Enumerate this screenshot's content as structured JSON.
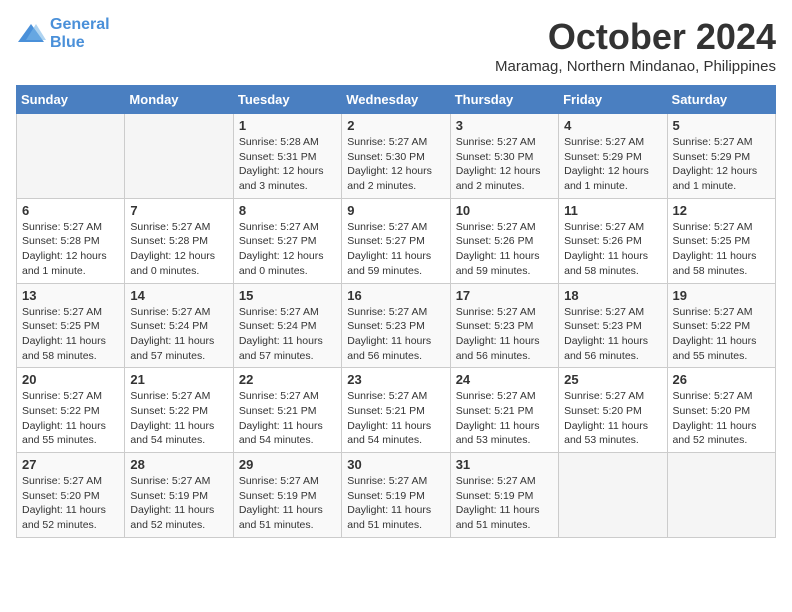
{
  "header": {
    "logo_line1": "General",
    "logo_line2": "Blue",
    "month": "October 2024",
    "location": "Maramag, Northern Mindanao, Philippines"
  },
  "weekdays": [
    "Sunday",
    "Monday",
    "Tuesday",
    "Wednesday",
    "Thursday",
    "Friday",
    "Saturday"
  ],
  "weeks": [
    [
      {
        "day": "",
        "detail": ""
      },
      {
        "day": "",
        "detail": ""
      },
      {
        "day": "1",
        "detail": "Sunrise: 5:28 AM\nSunset: 5:31 PM\nDaylight: 12 hours\nand 3 minutes."
      },
      {
        "day": "2",
        "detail": "Sunrise: 5:27 AM\nSunset: 5:30 PM\nDaylight: 12 hours\nand 2 minutes."
      },
      {
        "day": "3",
        "detail": "Sunrise: 5:27 AM\nSunset: 5:30 PM\nDaylight: 12 hours\nand 2 minutes."
      },
      {
        "day": "4",
        "detail": "Sunrise: 5:27 AM\nSunset: 5:29 PM\nDaylight: 12 hours\nand 1 minute."
      },
      {
        "day": "5",
        "detail": "Sunrise: 5:27 AM\nSunset: 5:29 PM\nDaylight: 12 hours\nand 1 minute."
      }
    ],
    [
      {
        "day": "6",
        "detail": "Sunrise: 5:27 AM\nSunset: 5:28 PM\nDaylight: 12 hours\nand 1 minute."
      },
      {
        "day": "7",
        "detail": "Sunrise: 5:27 AM\nSunset: 5:28 PM\nDaylight: 12 hours\nand 0 minutes."
      },
      {
        "day": "8",
        "detail": "Sunrise: 5:27 AM\nSunset: 5:27 PM\nDaylight: 12 hours\nand 0 minutes."
      },
      {
        "day": "9",
        "detail": "Sunrise: 5:27 AM\nSunset: 5:27 PM\nDaylight: 11 hours\nand 59 minutes."
      },
      {
        "day": "10",
        "detail": "Sunrise: 5:27 AM\nSunset: 5:26 PM\nDaylight: 11 hours\nand 59 minutes."
      },
      {
        "day": "11",
        "detail": "Sunrise: 5:27 AM\nSunset: 5:26 PM\nDaylight: 11 hours\nand 58 minutes."
      },
      {
        "day": "12",
        "detail": "Sunrise: 5:27 AM\nSunset: 5:25 PM\nDaylight: 11 hours\nand 58 minutes."
      }
    ],
    [
      {
        "day": "13",
        "detail": "Sunrise: 5:27 AM\nSunset: 5:25 PM\nDaylight: 11 hours\nand 58 minutes."
      },
      {
        "day": "14",
        "detail": "Sunrise: 5:27 AM\nSunset: 5:24 PM\nDaylight: 11 hours\nand 57 minutes."
      },
      {
        "day": "15",
        "detail": "Sunrise: 5:27 AM\nSunset: 5:24 PM\nDaylight: 11 hours\nand 57 minutes."
      },
      {
        "day": "16",
        "detail": "Sunrise: 5:27 AM\nSunset: 5:23 PM\nDaylight: 11 hours\nand 56 minutes."
      },
      {
        "day": "17",
        "detail": "Sunrise: 5:27 AM\nSunset: 5:23 PM\nDaylight: 11 hours\nand 56 minutes."
      },
      {
        "day": "18",
        "detail": "Sunrise: 5:27 AM\nSunset: 5:23 PM\nDaylight: 11 hours\nand 56 minutes."
      },
      {
        "day": "19",
        "detail": "Sunrise: 5:27 AM\nSunset: 5:22 PM\nDaylight: 11 hours\nand 55 minutes."
      }
    ],
    [
      {
        "day": "20",
        "detail": "Sunrise: 5:27 AM\nSunset: 5:22 PM\nDaylight: 11 hours\nand 55 minutes."
      },
      {
        "day": "21",
        "detail": "Sunrise: 5:27 AM\nSunset: 5:22 PM\nDaylight: 11 hours\nand 54 minutes."
      },
      {
        "day": "22",
        "detail": "Sunrise: 5:27 AM\nSunset: 5:21 PM\nDaylight: 11 hours\nand 54 minutes."
      },
      {
        "day": "23",
        "detail": "Sunrise: 5:27 AM\nSunset: 5:21 PM\nDaylight: 11 hours\nand 54 minutes."
      },
      {
        "day": "24",
        "detail": "Sunrise: 5:27 AM\nSunset: 5:21 PM\nDaylight: 11 hours\nand 53 minutes."
      },
      {
        "day": "25",
        "detail": "Sunrise: 5:27 AM\nSunset: 5:20 PM\nDaylight: 11 hours\nand 53 minutes."
      },
      {
        "day": "26",
        "detail": "Sunrise: 5:27 AM\nSunset: 5:20 PM\nDaylight: 11 hours\nand 52 minutes."
      }
    ],
    [
      {
        "day": "27",
        "detail": "Sunrise: 5:27 AM\nSunset: 5:20 PM\nDaylight: 11 hours\nand 52 minutes."
      },
      {
        "day": "28",
        "detail": "Sunrise: 5:27 AM\nSunset: 5:19 PM\nDaylight: 11 hours\nand 52 minutes."
      },
      {
        "day": "29",
        "detail": "Sunrise: 5:27 AM\nSunset: 5:19 PM\nDaylight: 11 hours\nand 51 minutes."
      },
      {
        "day": "30",
        "detail": "Sunrise: 5:27 AM\nSunset: 5:19 PM\nDaylight: 11 hours\nand 51 minutes."
      },
      {
        "day": "31",
        "detail": "Sunrise: 5:27 AM\nSunset: 5:19 PM\nDaylight: 11 hours\nand 51 minutes."
      },
      {
        "day": "",
        "detail": ""
      },
      {
        "day": "",
        "detail": ""
      }
    ]
  ]
}
